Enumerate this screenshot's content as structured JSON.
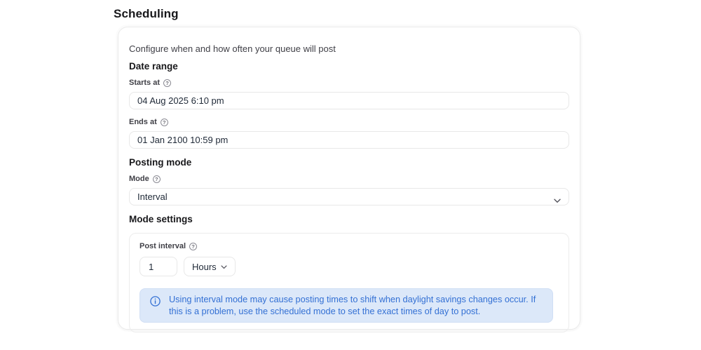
{
  "page": {
    "title": "Scheduling"
  },
  "panel": {
    "description": "Configure when and how often your queue will post",
    "date_range": {
      "heading": "Date range",
      "starts_at": {
        "label": "Starts at",
        "value": "04 Aug 2025 6:10 pm"
      },
      "ends_at": {
        "label": "Ends at",
        "value": "01 Jan 2100 10:59 pm"
      }
    },
    "posting_mode": {
      "heading": "Posting mode",
      "mode": {
        "label": "Mode",
        "value": "Interval"
      }
    },
    "mode_settings": {
      "heading": "Mode settings",
      "post_interval": {
        "label": "Post interval",
        "value": "1",
        "unit": "Hours"
      },
      "alert": {
        "text": "Using interval mode may cause posting times to shift when daylight savings changes occur. If this is a problem, use the scheduled mode to set the exact times of day to post."
      }
    }
  },
  "icons": {
    "help": "?"
  },
  "colors": {
    "alert_bg": "#dce8f9",
    "alert_text": "#3370d4",
    "input_border": "#e8e8e8"
  }
}
